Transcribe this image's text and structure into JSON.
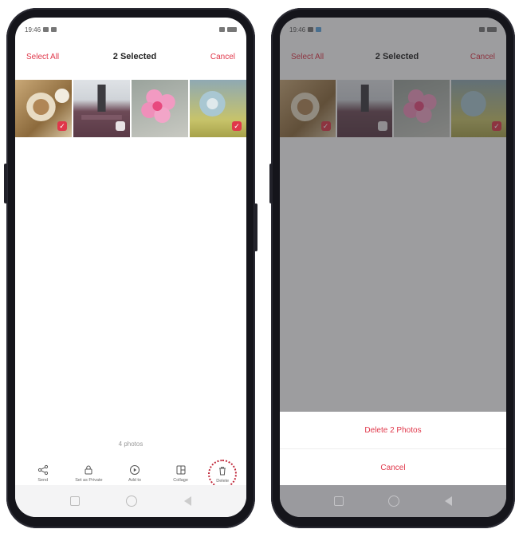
{
  "left_phone": {
    "status_bar": {
      "time": "19:46",
      "right_text": ""
    },
    "header": {
      "select_all": "Select All",
      "title": "2 Selected",
      "cancel": "Cancel"
    },
    "thumbnails": [
      {
        "name": "food-photo",
        "selected": true
      },
      {
        "name": "building-photo",
        "selected": false
      },
      {
        "name": "flower-photo",
        "selected": false
      },
      {
        "name": "toy-photo",
        "selected": true
      }
    ],
    "photo_count": "4 photos",
    "toolbar": [
      {
        "icon": "share-icon",
        "label": "Send"
      },
      {
        "icon": "lock-icon",
        "label": "Set as Private"
      },
      {
        "icon": "play-icon",
        "label": "Add to"
      },
      {
        "icon": "collage-icon",
        "label": "Collage"
      },
      {
        "icon": "trash-icon",
        "label": "Delete"
      }
    ]
  },
  "right_phone": {
    "status_bar": {
      "time": "19:46"
    },
    "header": {
      "select_all": "Select All",
      "title": "2 Selected",
      "cancel": "Cancel"
    },
    "sheet": {
      "delete_label": "Delete 2 Photos",
      "cancel_label": "Cancel"
    }
  },
  "colors": {
    "accent": "#e0374a",
    "dim_overlay": "#8b8b8f"
  }
}
